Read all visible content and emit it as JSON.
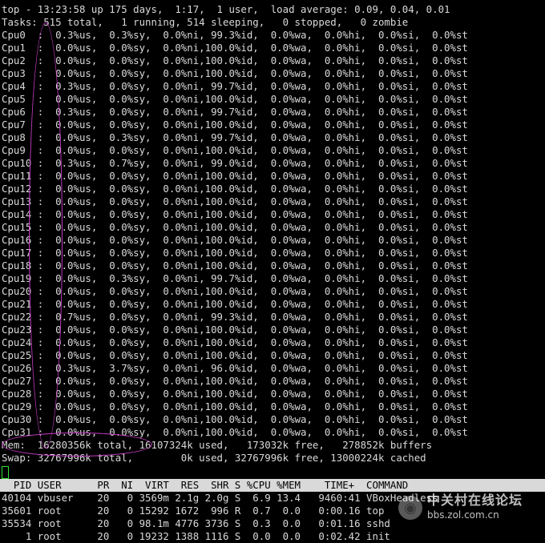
{
  "summary": {
    "line1": "top - 13:23:58 up 175 days,  1:17,  1 user,  load average: 0.09, 0.04, 0.01",
    "line2": "Tasks: 515 total,   1 running, 514 sleeping,   0 stopped,   0 zombie"
  },
  "cpus": [
    "Cpu0  :  0.3%us,  0.3%sy,  0.0%ni, 99.3%id,  0.0%wa,  0.0%hi,  0.0%si,  0.0%st",
    "Cpu1  :  0.0%us,  0.0%sy,  0.0%ni,100.0%id,  0.0%wa,  0.0%hi,  0.0%si,  0.0%st",
    "Cpu2  :  0.0%us,  0.0%sy,  0.0%ni,100.0%id,  0.0%wa,  0.0%hi,  0.0%si,  0.0%st",
    "Cpu3  :  0.0%us,  0.0%sy,  0.0%ni,100.0%id,  0.0%wa,  0.0%hi,  0.0%si,  0.0%st",
    "Cpu4  :  0.3%us,  0.0%sy,  0.0%ni, 99.7%id,  0.0%wa,  0.0%hi,  0.0%si,  0.0%st",
    "Cpu5  :  0.0%us,  0.0%sy,  0.0%ni,100.0%id,  0.0%wa,  0.0%hi,  0.0%si,  0.0%st",
    "Cpu6  :  0.3%us,  0.0%sy,  0.0%ni, 99.7%id,  0.0%wa,  0.0%hi,  0.0%si,  0.0%st",
    "Cpu7  :  0.0%us,  0.0%sy,  0.0%ni,100.0%id,  0.0%wa,  0.0%hi,  0.0%si,  0.0%st",
    "Cpu8  :  0.0%us,  0.3%sy,  0.0%ni, 99.7%id,  0.0%wa,  0.0%hi,  0.0%si,  0.0%st",
    "Cpu9  :  0.0%us,  0.0%sy,  0.0%ni,100.0%id,  0.0%wa,  0.0%hi,  0.0%si,  0.0%st",
    "Cpu10 :  0.3%us,  0.7%sy,  0.0%ni, 99.0%id,  0.0%wa,  0.0%hi,  0.0%si,  0.0%st",
    "Cpu11 :  0.0%us,  0.0%sy,  0.0%ni,100.0%id,  0.0%wa,  0.0%hi,  0.0%si,  0.0%st",
    "Cpu12 :  0.0%us,  0.0%sy,  0.0%ni,100.0%id,  0.0%wa,  0.0%hi,  0.0%si,  0.0%st",
    "Cpu13 :  0.0%us,  0.0%sy,  0.0%ni,100.0%id,  0.0%wa,  0.0%hi,  0.0%si,  0.0%st",
    "Cpu14 :  0.0%us,  0.0%sy,  0.0%ni,100.0%id,  0.0%wa,  0.0%hi,  0.0%si,  0.0%st",
    "Cpu15 :  0.0%us,  0.0%sy,  0.0%ni,100.0%id,  0.0%wa,  0.0%hi,  0.0%si,  0.0%st",
    "Cpu16 :  0.0%us,  0.0%sy,  0.0%ni,100.0%id,  0.0%wa,  0.0%hi,  0.0%si,  0.0%st",
    "Cpu17 :  0.0%us,  0.0%sy,  0.0%ni,100.0%id,  0.0%wa,  0.0%hi,  0.0%si,  0.0%st",
    "Cpu18 :  0.0%us,  0.0%sy,  0.0%ni,100.0%id,  0.0%wa,  0.0%hi,  0.0%si,  0.0%st",
    "Cpu19 :  0.0%us,  0.3%sy,  0.0%ni, 99.7%id,  0.0%wa,  0.0%hi,  0.0%si,  0.0%st",
    "Cpu20 :  0.0%us,  0.0%sy,  0.0%ni,100.0%id,  0.0%wa,  0.0%hi,  0.0%si,  0.0%st",
    "Cpu21 :  0.0%us,  0.0%sy,  0.0%ni,100.0%id,  0.0%wa,  0.0%hi,  0.0%si,  0.0%st",
    "Cpu22 :  0.7%us,  0.0%sy,  0.0%ni, 99.3%id,  0.0%wa,  0.0%hi,  0.0%si,  0.0%st",
    "Cpu23 :  0.0%us,  0.0%sy,  0.0%ni,100.0%id,  0.0%wa,  0.0%hi,  0.0%si,  0.0%st",
    "Cpu24 :  0.0%us,  0.0%sy,  0.0%ni,100.0%id,  0.0%wa,  0.0%hi,  0.0%si,  0.0%st",
    "Cpu25 :  0.0%us,  0.0%sy,  0.0%ni,100.0%id,  0.0%wa,  0.0%hi,  0.0%si,  0.0%st",
    "Cpu26 :  0.3%us,  3.7%sy,  0.0%ni, 96.0%id,  0.0%wa,  0.0%hi,  0.0%si,  0.0%st",
    "Cpu27 :  0.0%us,  0.0%sy,  0.0%ni,100.0%id,  0.0%wa,  0.0%hi,  0.0%si,  0.0%st",
    "Cpu28 :  0.0%us,  0.0%sy,  0.0%ni,100.0%id,  0.0%wa,  0.0%hi,  0.0%si,  0.0%st",
    "Cpu29 :  0.0%us,  0.0%sy,  0.0%ni,100.0%id,  0.0%wa,  0.0%hi,  0.0%si,  0.0%st",
    "Cpu30 :  0.0%us,  0.0%sy,  0.0%ni,100.0%id,  0.0%wa,  0.0%hi,  0.0%si,  0.0%st",
    "Cpu31 :  0.0%us,  0.0%sy,  0.0%ni,100.0%id,  0.0%wa,  0.0%hi,  0.0%si,  0.0%st"
  ],
  "memory": {
    "mem": "Mem:  16280356k total, 16107324k used,   173032k free,   278852k buffers",
    "swap": "Swap: 32767996k total,        0k used, 32767996k free, 13000224k cached"
  },
  "process_header": "  PID USER      PR  NI  VIRT  RES  SHR S %CPU %MEM    TIME+  COMMAND",
  "processes": [
    "40104 vbuser    20   0 3569m 2.1g 2.0g S  6.9 13.4   9460:41 VBoxHeadless",
    "35601 root      20   0 15292 1672  996 R  0.7  0.0   0:00.16 top",
    "35534 root      20   0 98.1m 4776 3736 S  0.3  0.0   0:01.16 sshd",
    "    1 root      20   0 19232 1388 1116 S  0.0  0.0   0:02.42 init"
  ],
  "watermark": {
    "title": "中关村在线论坛",
    "url": "bbs.zol.com.cn"
  },
  "colors": {
    "background": "#000000",
    "text": "#d9d9d9",
    "header_bg": "#d9d9d9",
    "cursor": "#2ee32e",
    "annotation": "#c23bc2"
  }
}
